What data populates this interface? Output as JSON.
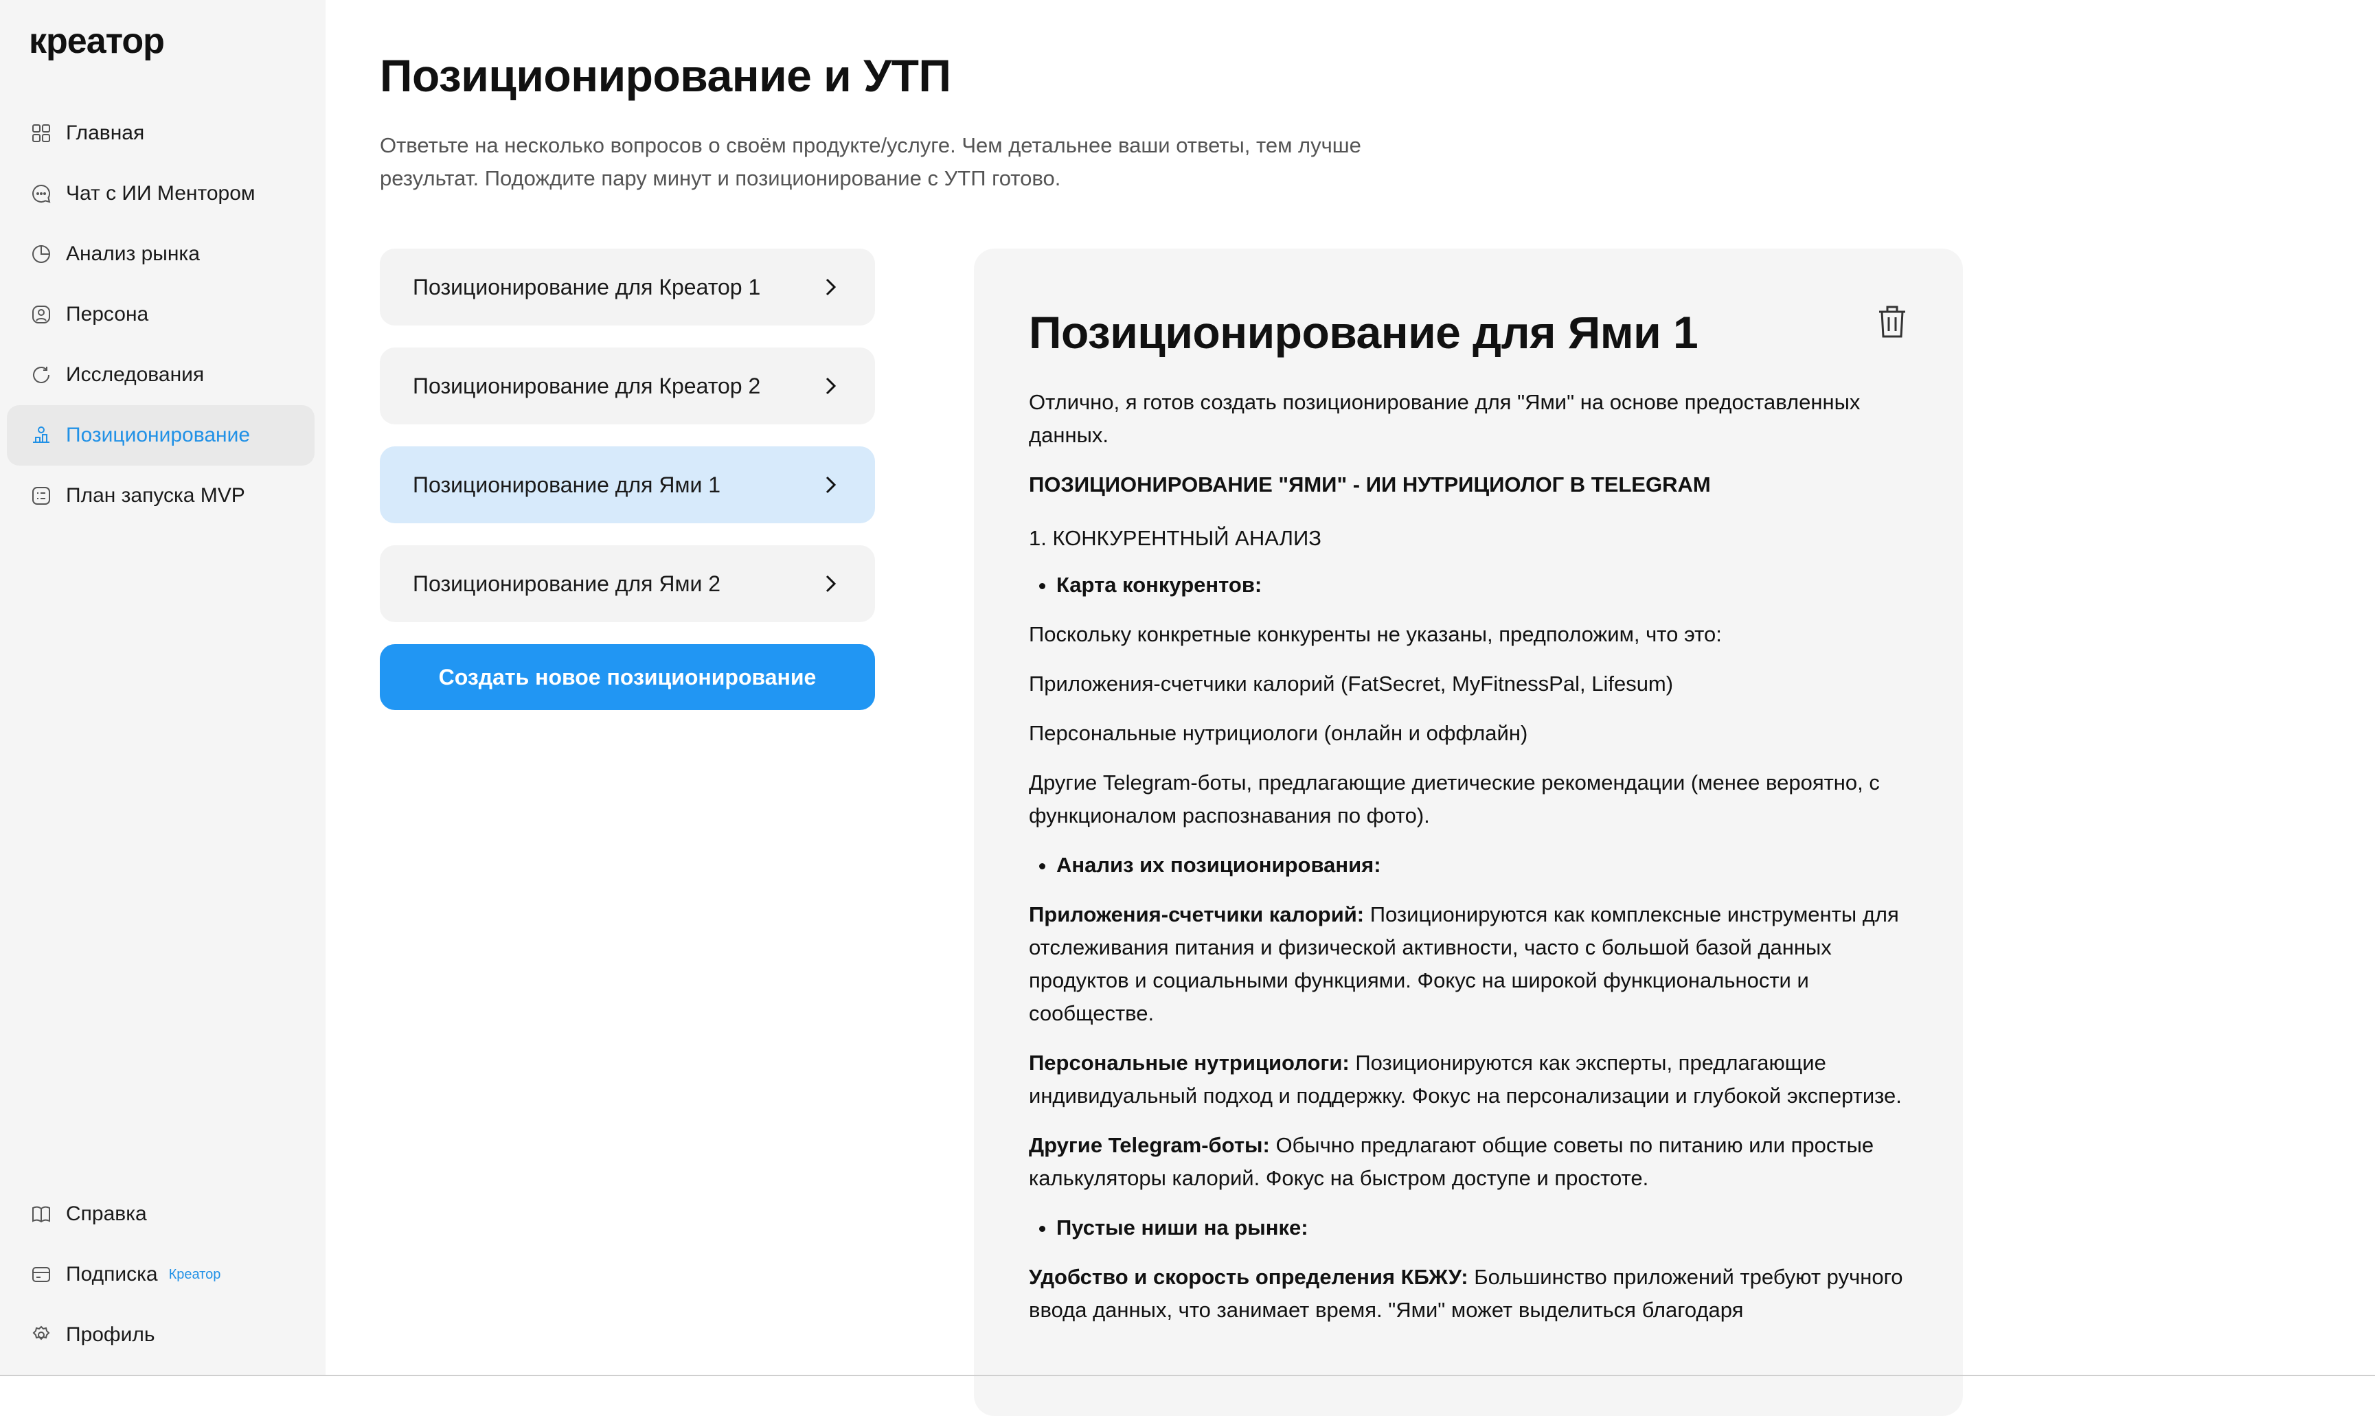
{
  "app": {
    "logo": "креатор"
  },
  "sidebar": {
    "items": [
      {
        "label": "Главная",
        "icon": "grid-icon"
      },
      {
        "label": "Чат с ИИ Ментором",
        "icon": "chat-icon"
      },
      {
        "label": "Анализ рынка",
        "icon": "pie-chart-icon"
      },
      {
        "label": "Персона",
        "icon": "person-icon"
      },
      {
        "label": "Исследования",
        "icon": "refresh-icon"
      },
      {
        "label": "Позиционирование",
        "icon": "positioning-icon",
        "active": true
      },
      {
        "label": "План запуска MVP",
        "icon": "plan-icon"
      }
    ],
    "bottom_items": [
      {
        "label": "Справка",
        "icon": "book-icon"
      },
      {
        "label": "Подписка",
        "icon": "subscription-icon",
        "badge": "Креатор"
      },
      {
        "label": "Профиль",
        "icon": "gear-icon"
      }
    ],
    "accent_color": "#2191e6"
  },
  "main": {
    "title": "Позиционирование и УТП",
    "description": "Ответьте на несколько вопросов о своём продукте/услуге. Чем детальнее ваши ответы, тем лучше результат. Подождите пару минут и позиционирование с УТП готово.",
    "list": [
      {
        "label": "Позиционирование для Креатор 1"
      },
      {
        "label": "Позиционирование для Креатор 2"
      },
      {
        "label": "Позиционирование для Ями 1",
        "selected": true
      },
      {
        "label": "Позиционирование для Ями 2"
      }
    ],
    "create_button": "Создать новое позиционирование",
    "button_color": "#2196f3"
  },
  "panel": {
    "title": "Позиционирование для Ями 1",
    "intro": "Отлично, я готов создать позиционирование для \"Ями\" на основе предоставленных данных.",
    "heading": "ПОЗИЦИОНИРОВАНИЕ \"ЯМИ\" - ИИ НУТРИЦИОЛОГ В TELEGRAM",
    "section1": "1. КОНКУРЕНТНЫЙ АНАЛИЗ",
    "bullet1": "Карта конкурентов:",
    "p1": "Поскольку конкретные конкуренты не указаны, предположим, что это:",
    "p2": "Приложения-счетчики калорий (FatSecret, MyFitnessPal, Lifesum)",
    "p3": "Персональные нутрициологи (онлайн и оффлайн)",
    "p4": "Другие Telegram-боты, предлагающие диетические рекомендации (менее вероятно, с функционалом распознавания по фото).",
    "bullet2": "Анализ их позиционирования:",
    "a1_bold": "Приложения-счетчики калорий:",
    "a1_text": " Позиционируются как комплексные инструменты для отслеживания питания и физической активности, часто с большой базой данных продуктов и социальными функциями. Фокус на широкой функциональности и сообществе.",
    "a2_bold": "Персональные нутрициологи:",
    "a2_text": " Позиционируются как эксперты, предлагающие индивидуальный подход и поддержку. Фокус на персонализации и глубокой экспертизе.",
    "a3_bold": "Другие Telegram-боты:",
    "a3_text": " Обычно предлагают общие советы по питанию или простые калькуляторы калорий. Фокус на быстром доступе и простоте.",
    "bullet3": "Пустые ниши на рынке:",
    "a4_bold": "Удобство и скорость определения КБЖУ:",
    "a4_text": " Большинство приложений требуют ручного ввода данных, что занимает время. \"Ями\" может выделиться благодаря"
  }
}
